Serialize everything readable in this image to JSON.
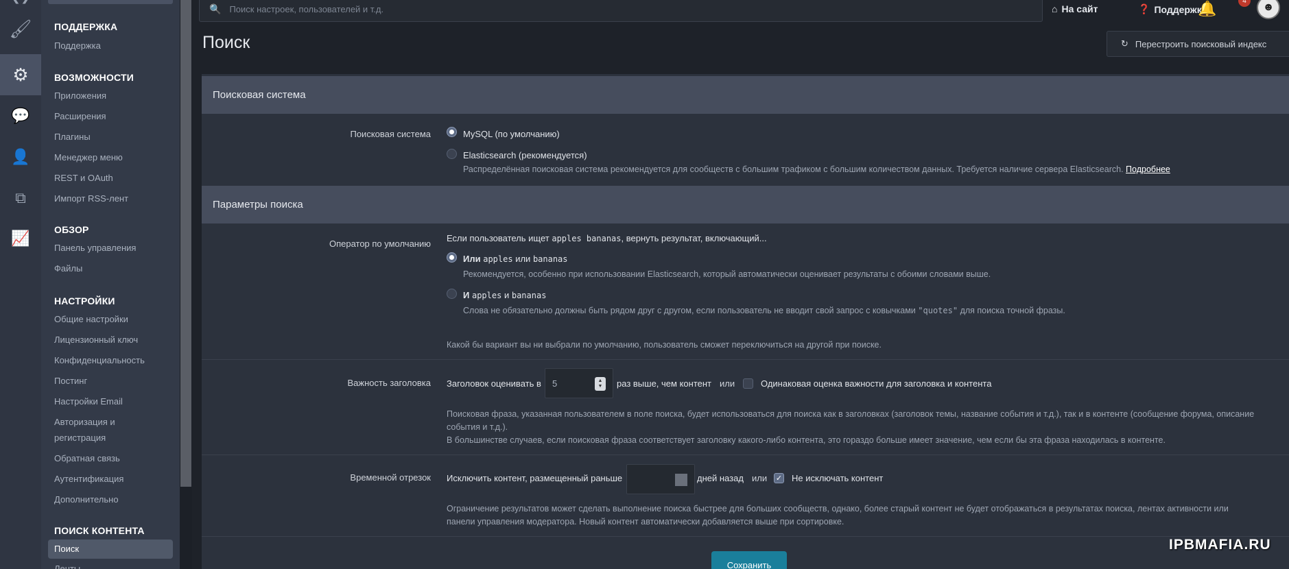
{
  "topbar": {
    "search_placeholder": "Поиск настроек, пользователей и т.д.",
    "to_site": "На сайт",
    "support": "Поддержка",
    "notif_count": "4"
  },
  "iconbar": {
    "icons": [
      "paintbrush-icon",
      "gears-icon",
      "chat-icon",
      "user-icon",
      "copy-icon",
      "chart-icon"
    ]
  },
  "sidebar": {
    "sections": [
      {
        "title": "ПОДДЕРЖКА",
        "items": [
          "Поддержка"
        ]
      },
      {
        "title": "ВОЗМОЖНОСТИ",
        "items": [
          "Приложения",
          "Расширения",
          "Плагины",
          "Менеджер меню",
          "REST и OAuth",
          "Импорт RSS-лент"
        ]
      },
      {
        "title": "ОБЗОР",
        "items": [
          "Панель управления",
          "Файлы"
        ]
      },
      {
        "title": "НАСТРОЙКИ",
        "items": [
          "Общие настройки",
          "Лицензионный ключ",
          "Конфиденциальность",
          "Постинг",
          "Настройки Email",
          "Авторизация и",
          "регистрация",
          "Обратная связь",
          "Аутентификация",
          "Дополнительно"
        ]
      },
      {
        "title": "ПОИСК КОНТЕНТА",
        "items": [
          "Поиск",
          "Ленты"
        ]
      }
    ]
  },
  "page": {
    "title": "Поиск",
    "rebuild_button": "Перестроить поисковый индекс"
  },
  "form": {
    "engine_section": "Поисковая система",
    "engine_label": "Поисковая система",
    "engine_mysql": "MySQL (по умолчанию)",
    "engine_elastic": "Elasticsearch (рекомендуется)",
    "engine_elastic_desc": "Распределённая поисковая система рекомендуется для сообществ с большим трафиком с большим количеством данных. Требуется наличие сервера Elasticsearch.",
    "engine_more_link": "Подробнее",
    "params_section": "Параметры поиска",
    "operator_label": "Оператор по умолчанию",
    "operator_intro_a": "Если пользователь ищет",
    "operator_intro_code": "apples bananas",
    "operator_intro_b": ", вернуть результат, включающий...",
    "or_bold": "Или",
    "or_w1": "apples",
    "or_mid": "или",
    "or_w2": "bananas",
    "or_desc": "Рекомендуется, особенно при использовании Elasticsearch, который автоматически оценивает результаты с обоими словами выше.",
    "and_bold": "И",
    "and_w1": "apples",
    "and_mid": "и",
    "and_w2": "bananas",
    "and_desc_a": "Слова не обязательно должны быть рядом друг с другом, если пользователь не вводит свой запрос с ковычками",
    "and_desc_code": "\"quotes\"",
    "and_desc_b": "для поиска точной фразы.",
    "operator_note": "Какой бы вариант вы ни выбрали по умолчанию, пользователь сможет переключиться на другой при поиске.",
    "title_weight_label": "Важность заголовка",
    "title_weight_pre": "Заголовок оценивать в",
    "title_weight_value": "5",
    "title_weight_post": "раз выше, чем контент",
    "or_word": "или",
    "title_weight_equal": "Одинаковая оценка важности для заголовка и контента",
    "title_weight_desc1": "Поисковая фраза, указанная пользователем в поле поиска, будет использоваться для поиска как в заголовках (заголовок темы, название события и т.д.), так и в контенте (сообщение форума, описание",
    "title_weight_desc2": "события и т.д.).",
    "title_weight_desc3": "В большинстве случаев, если поисковая фраза соответствует заголовку какого-либо контента, это гораздо больше имеет значение, чем если бы эта фраза находилась в контенте.",
    "timeframe_label": "Временной отрезок",
    "timeframe_pre": "Исключить контент, размещенный раньше",
    "timeframe_post": "дней назад",
    "timeframe_noexclude": "Не исключать контент",
    "timeframe_desc1": "Ограничение результатов может сделать выполнение поиска быстрее для больших сообществ, однако, более старый контент не будет отображаться в результатах поиска, лентах активности или",
    "timeframe_desc2": "панели управления модератора. Новый контент автоматически добавляется выше при сортировке.",
    "save_button": "Сохранить"
  },
  "watermark": "IPBMAFIA.RU"
}
